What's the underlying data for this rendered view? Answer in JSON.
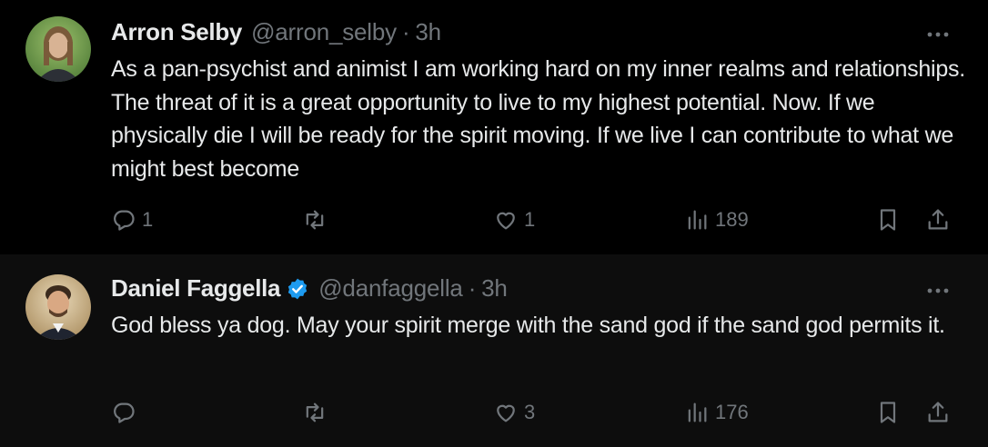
{
  "tweets": [
    {
      "author": "Arron Selby",
      "handle": "@arron_selby",
      "separator": "·",
      "time": "3h",
      "verified": false,
      "text": "As a pan-psychist and animist I am working hard on my inner realms and relationships. The threat of it is a great opportunity to live to my highest potential. Now. If we physically die I will be ready for the spirit moving. If we live I can contribute to what we might best become",
      "replies": "1",
      "retweets": "",
      "likes": "1",
      "views": "189"
    },
    {
      "author": "Daniel Faggella",
      "handle": "@danfaggella",
      "separator": "·",
      "time": "3h",
      "verified": true,
      "text": "God bless ya dog. May your spirit merge with the sand god if the sand god permits it.",
      "replies": "",
      "retweets": "",
      "likes": "3",
      "views": "176"
    }
  ],
  "colors": {
    "background": "#000000",
    "text": "#e7e9ea",
    "muted": "#71767b",
    "verified": "#1d9bf0"
  },
  "icons": [
    "avatar",
    "verified-badge-icon",
    "more-icon",
    "reply-icon",
    "retweet-icon",
    "like-icon",
    "views-icon",
    "bookmark-icon",
    "share-icon"
  ]
}
